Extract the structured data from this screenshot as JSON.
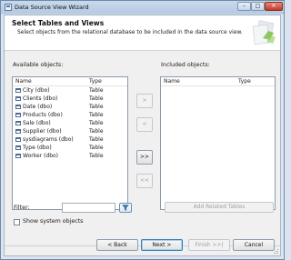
{
  "window": {
    "title": "Data Source View Wizard",
    "min_glyph": "–",
    "max_glyph": "□",
    "close_glyph": "✕"
  },
  "header": {
    "title": "Select Tables and Views",
    "subtitle": "Select objects from the relational database to be included in the data source view."
  },
  "available": {
    "label": "Available objects:",
    "columns": [
      "Name",
      "Type"
    ],
    "rows": [
      {
        "name": "City (dbo)",
        "type": "Table"
      },
      {
        "name": "Clients (dbo)",
        "type": "Table"
      },
      {
        "name": "Date (dbo)",
        "type": "Table"
      },
      {
        "name": "Products (dbo)",
        "type": "Table"
      },
      {
        "name": "Sale (dbo)",
        "type": "Table"
      },
      {
        "name": "Supplier (dbo)",
        "type": "Table"
      },
      {
        "name": "sysdiagrams (dbo)",
        "type": "Table"
      },
      {
        "name": "Type (dbo)",
        "type": "Table"
      },
      {
        "name": "Worker (dbo)",
        "type": "Table"
      }
    ]
  },
  "included": {
    "label": "Included objects:",
    "columns": [
      "Name",
      "Type"
    ]
  },
  "move_buttons": {
    "add": ">",
    "remove": "<",
    "add_all": ">>",
    "remove_all": "<<"
  },
  "filter": {
    "label": "Filter:",
    "value": ""
  },
  "show_system_objects": {
    "label": "Show system objects",
    "checked": false
  },
  "add_related_label": "Add Related Tables",
  "nav": {
    "back": "< Back",
    "next": "Next >",
    "finish": "Finish >>|",
    "cancel": "Cancel"
  },
  "colors": {
    "accent": "#3c7fb1",
    "title_bar": "#b5c9e2",
    "graphic_green": "#7cbf4a"
  },
  "icons": {
    "table": "table-icon",
    "filter": "funnel-icon",
    "wizard": "wizard-graphic"
  }
}
